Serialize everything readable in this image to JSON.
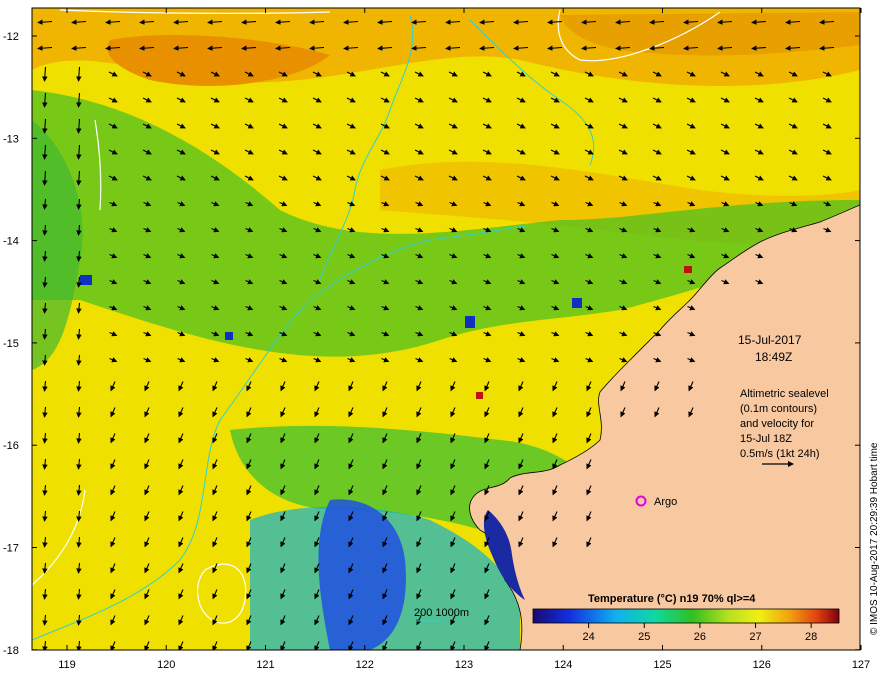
{
  "map": {
    "lon_ticks": [
      "119",
      "120",
      "121",
      "122",
      "123",
      "124",
      "125",
      "126",
      "127"
    ],
    "lat_ticks": [
      "-12",
      "-13",
      "-14",
      "-15",
      "-16",
      "-17",
      "-18"
    ],
    "date": "15-Jul-2017",
    "time": "18:49Z",
    "annotation_lines": [
      "Altimetric sealevel",
      "(0.1m contours)",
      "and velocity for",
      "15-Jul 18Z",
      "0.5m/s (1kt 24h)"
    ],
    "argo_label": "Argo",
    "bathy_label": "200  1000m",
    "credit": "© IMOS 10-Aug-2017 20:29:39 Hobart time",
    "colors": {
      "land": "#f8c8a0",
      "contour_bathy": "#30d0d0",
      "argo_marker": "#e000e0",
      "sealevel_contour": "#ffffff"
    },
    "colorbar": {
      "title": "Temperature (°C) n19 70% ql>=4",
      "tick_labels": [
        "24",
        "25",
        "26",
        "27",
        "28"
      ],
      "range": [
        23,
        28.5
      ]
    }
  }
}
